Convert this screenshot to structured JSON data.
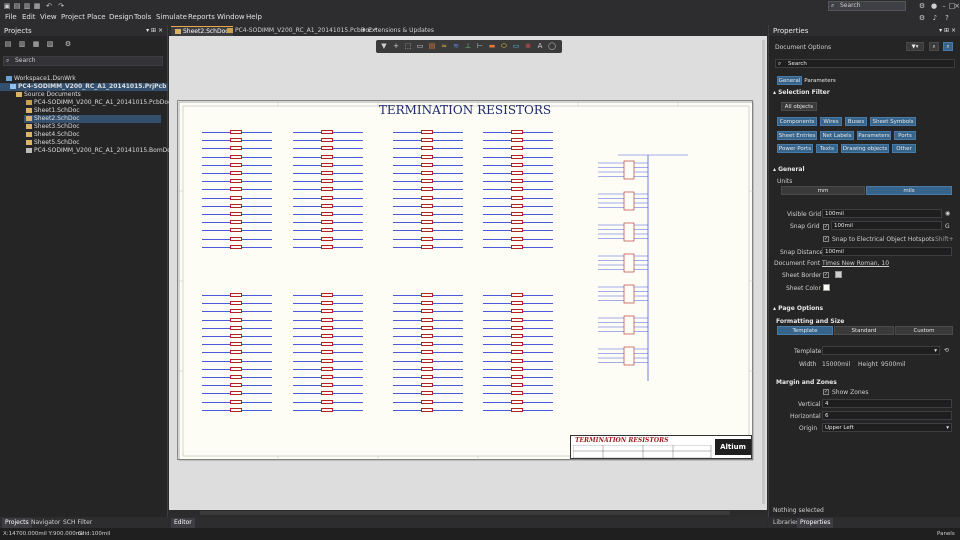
{
  "titlebar": {
    "search_label": "Search",
    "icons": [
      "settings-icon",
      "notifications-icon",
      "account-icon",
      "help-icon",
      "minimize-icon",
      "maximize-icon",
      "close-icon"
    ]
  },
  "menu": [
    "File",
    "Edit",
    "View",
    "Project",
    "Place",
    "Design",
    "Tools",
    "Simulate",
    "Reports",
    "Window",
    "Help"
  ],
  "projects_panel": {
    "title": "Projects",
    "search_placeholder": "Search",
    "tree": [
      {
        "label": "Workspace1.DsnWrk",
        "level": 0,
        "icon": "workspace"
      },
      {
        "label": "PC4-SODIMM_V200_RC_A1_20141015.PrjPcb",
        "level": 1,
        "icon": "project",
        "selected": true
      },
      {
        "label": "Source Documents",
        "level": 2,
        "icon": "folder"
      },
      {
        "label": "PC4-SODIMM_V200_RC_A1_20141015.PcbDoc",
        "level": 3,
        "icon": "pcb"
      },
      {
        "label": "Sheet1.SchDoc",
        "level": 3,
        "icon": "sch"
      },
      {
        "label": "Sheet2.SchDoc",
        "level": 3,
        "icon": "sch",
        "active": true
      },
      {
        "label": "Sheet3.SchDoc",
        "level": 3,
        "icon": "sch"
      },
      {
        "label": "Sheet4.SchDoc",
        "level": 3,
        "icon": "sch"
      },
      {
        "label": "Sheet5.SchDoc",
        "level": 3,
        "icon": "sch"
      },
      {
        "label": "PC4-SODIMM_V200_RC_A1_20141015.BomDoc",
        "level": 3,
        "icon": "bom"
      }
    ]
  },
  "doc_tabs": [
    {
      "label": "Sheet2.SchDoc",
      "active": true
    },
    {
      "label": "PC4-SODIMM_V200_RC_A1_20141015.PcbDoc *",
      "active": false
    },
    {
      "label": "Extensions & Updates",
      "active": false
    }
  ],
  "schematic": {
    "title": "TERMINATION RESISTORS",
    "block_title": "TERMINATION RESISTORS",
    "logo": "Altium"
  },
  "properties": {
    "title": "Properties",
    "doc_options": "Document Options",
    "search_placeholder": "Search",
    "tabs": [
      "General",
      "Parameters"
    ],
    "selection_filter": {
      "header": "Selection Filter",
      "all_objects": "All objects",
      "chips": [
        "Components",
        "Wires",
        "Buses",
        "Sheet Symbols",
        "Sheet Entries",
        "Net Labels",
        "Parameters",
        "Ports",
        "Power Ports",
        "Texts",
        "Drawing objects",
        "Other"
      ]
    },
    "general": {
      "header": "General",
      "units_label": "Units",
      "units": [
        "mm",
        "mils"
      ],
      "units_selected": "mils",
      "visible_grid_label": "Visible Grid",
      "visible_grid": "100mil",
      "snap_grid_label": "Snap Grid",
      "snap_grid": "100mil",
      "snap_hotspots": "Snap to Electrical Object Hotspots",
      "snap_shortcut": "Shift+",
      "snap_distance_label": "Snap Distance",
      "snap_distance": "100mil",
      "document_font_label": "Document Font",
      "document_font": "Times New Roman, 10",
      "sheet_border_label": "Sheet Border",
      "sheet_color_label": "Sheet Color"
    },
    "page_options": {
      "header": "Page Options",
      "fs_header": "Formatting and Size",
      "fs_buttons": [
        "Template",
        "Standard",
        "Custom"
      ],
      "template_label": "Template",
      "width_label": "Width",
      "width": "15000mil",
      "height_label": "Height",
      "height": "9500mil",
      "margin_header": "Margin and Zones",
      "show_zones": "Show Zones",
      "vertical_label": "Vertical",
      "vertical": "4",
      "horizontal_label": "Horizontal",
      "horizontal": "6",
      "origin_label": "Origin",
      "origin": "Upper Left"
    },
    "status": "Nothing selected"
  },
  "bottom_tabs_left": [
    "Projects",
    "Navigator",
    "SCH Filter"
  ],
  "bottom_tab_center": "Editor",
  "bottom_tabs_right": [
    "Libraries",
    "Properties"
  ],
  "statusbar": {
    "coords": "X:14700.000mil Y:900.000mil",
    "grid": "Grid:100mil",
    "panels": "Panels"
  },
  "colors": {
    "accent": "#36648b",
    "wire": "#4a5adb",
    "component": "#b22222",
    "sheet": "#fdfdf6"
  }
}
